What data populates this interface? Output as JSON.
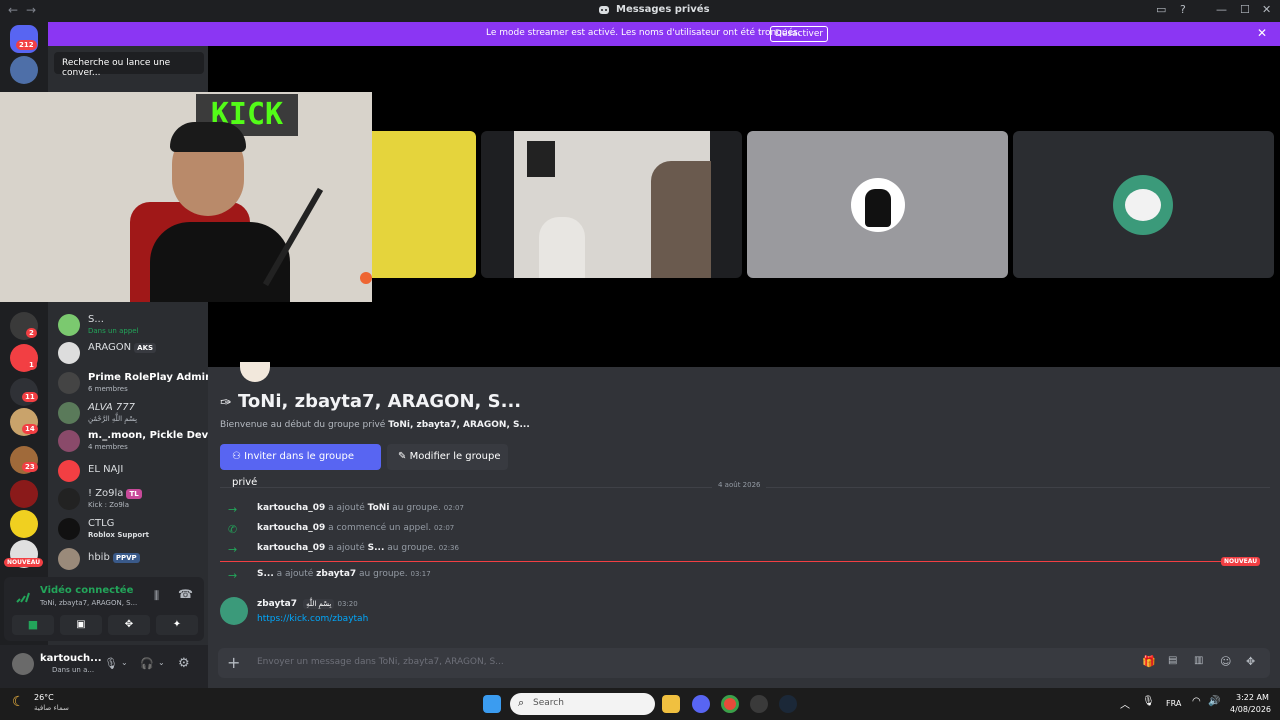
{
  "titlebar": {
    "title": "Messages privés",
    "back": "←",
    "forward": "→"
  },
  "banner": {
    "message": "Le mode streamer est activé. Les noms d'utilisateur ont été tronqués.",
    "button": "Désactiver",
    "close": "✕"
  },
  "guilds": {
    "home_badge": "212",
    "badges": [
      "2",
      "1",
      "11",
      "14",
      "23"
    ],
    "new_label": "NOUVEAU"
  },
  "search": {
    "placeholder": "Recherche ou lance une conver..."
  },
  "webcam": {
    "sign_text": "KICK"
  },
  "dms": [
    {
      "name": "S...",
      "sub": "Dans un appel",
      "tag": ""
    },
    {
      "name": "ARAGON",
      "sub": "",
      "tag": "AKS"
    },
    {
      "name": "Prime RolePlay Admin...",
      "sub": "6 membres",
      "tag": ""
    },
    {
      "name": "ALVA 777",
      "sub": "بِسْمِ اللَّهِ الرَّحْمَٰنِ",
      "tag": ""
    },
    {
      "name": "m._.moon, Pickle Devil...",
      "sub": "4 membres",
      "tag": ""
    },
    {
      "name": "EL NAJI",
      "sub": "",
      "tag": ""
    },
    {
      "name": "! Zo9la",
      "sub": "Kick : Zo9la",
      "tag": "TL"
    },
    {
      "name": "CTLG",
      "sub": "Roblox Support",
      "tag": ""
    },
    {
      "name": "hbib",
      "sub": "",
      "tag": "PPVP"
    }
  ],
  "voice": {
    "status": "Vidéo connectée",
    "channel": "ToNi, zbayta7, ARAGON, S..."
  },
  "user": {
    "name": "kartouch...",
    "status": "Dans un a..."
  },
  "group": {
    "title": "ToNi, zbayta7, ARAGON, S...",
    "intro_prefix": "Bienvenue au début du groupe privé",
    "intro_name": "ToNi, zbayta7, ARAGON, S...",
    "invite_button": "Inviter dans le groupe privé",
    "edit_button": "Modifier le groupe"
  },
  "date_divider": "4 août 2026",
  "new_label": "NOUVEAU",
  "events": [
    {
      "actor": "kartoucha_09",
      "action": "a ajouté",
      "target": "ToNi",
      "tail": "au groupe.",
      "time": "02:07",
      "icon": "arrow"
    },
    {
      "actor": "kartoucha_09",
      "action": "a commencé un appel.",
      "target": "",
      "tail": "",
      "time": "02:07",
      "icon": "phone"
    },
    {
      "actor": "kartoucha_09",
      "action": "a ajouté",
      "target": "S...",
      "tail": "au groupe.",
      "time": "02:36",
      "icon": "arrow"
    },
    {
      "actor": "S...",
      "action": "a ajouté",
      "target": "zbayta7",
      "tail": "au groupe.",
      "time": "03:17",
      "icon": "arrow"
    }
  ],
  "message": {
    "author": "zbayta7",
    "tag": "بِسْمِ اللَّهِ",
    "time": "03:20",
    "link": "https://kick.com/zbaytah"
  },
  "composer": {
    "placeholder": "Envoyer un message dans ToNi, zbayta7, ARAGON, S..."
  },
  "taskbar": {
    "weather_temp": "26°C",
    "weather_desc": "سماء صافية",
    "search": "Search",
    "lang": "FRA",
    "time": "3:22 AM",
    "date": "4/08/2026"
  },
  "colors": {
    "brand": "#5865f2",
    "streamer": "#8b36f3",
    "green": "#23a55a",
    "red": "#f23f43",
    "link": "#00a8fc"
  }
}
